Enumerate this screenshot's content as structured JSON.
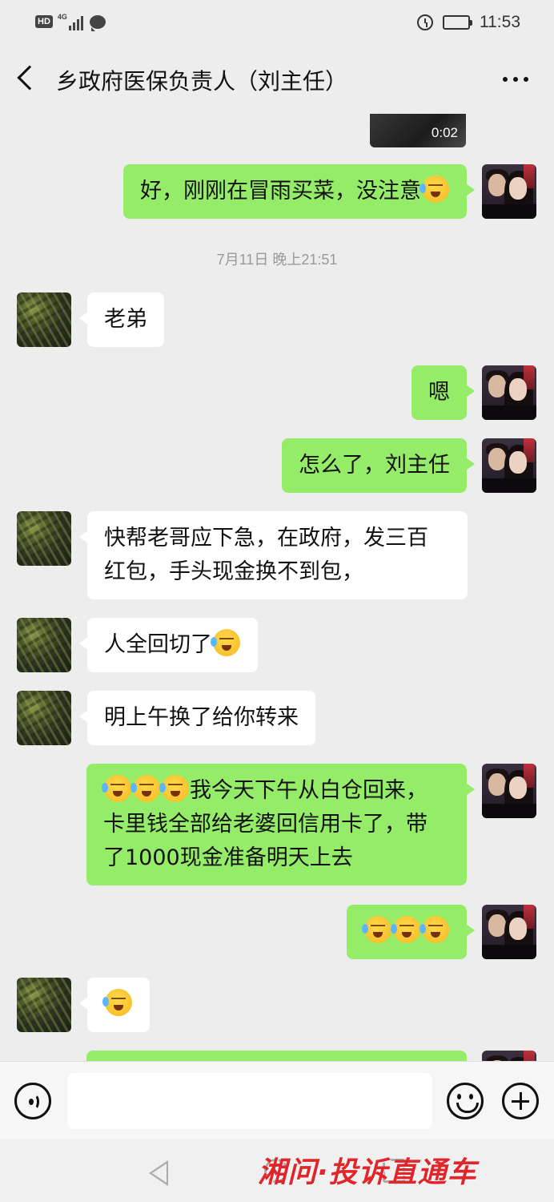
{
  "status_bar": {
    "hd": "HD",
    "network": "4G",
    "time": "11:53"
  },
  "header": {
    "title": "乡政府医保负责人（刘主任）"
  },
  "chat": {
    "video_duration": "0:02",
    "timestamp": "7月11日 晚上21:51",
    "messages": [
      {
        "from": "me",
        "text": "好，刚刚在冒雨买菜，没注意"
      },
      {
        "from": "other",
        "text": "老弟"
      },
      {
        "from": "me",
        "text": "嗯"
      },
      {
        "from": "me",
        "text": "怎么了，刘主任"
      },
      {
        "from": "other",
        "text_line1": "快帮老哥应下急，在政府，发三百",
        "text_line2": "红包，手头现金换不到包，"
      },
      {
        "from": "other",
        "text": "人全回切了"
      },
      {
        "from": "other",
        "text": "明上午换了给你转来"
      },
      {
        "from": "me",
        "text_line1": "我今天下午从白仓回来，",
        "text_line2": "卡里钱全部给老婆回信用卡了，带",
        "text_line3": "了1000现金准备明天上去"
      },
      {
        "from": "me",
        "text": ""
      },
      {
        "from": "other",
        "text": ""
      }
    ]
  },
  "watermark": "湘问·投诉直通车",
  "colors": {
    "my_bubble": "#95ec69",
    "other_bubble": "#ffffff",
    "background": "#ededed"
  }
}
